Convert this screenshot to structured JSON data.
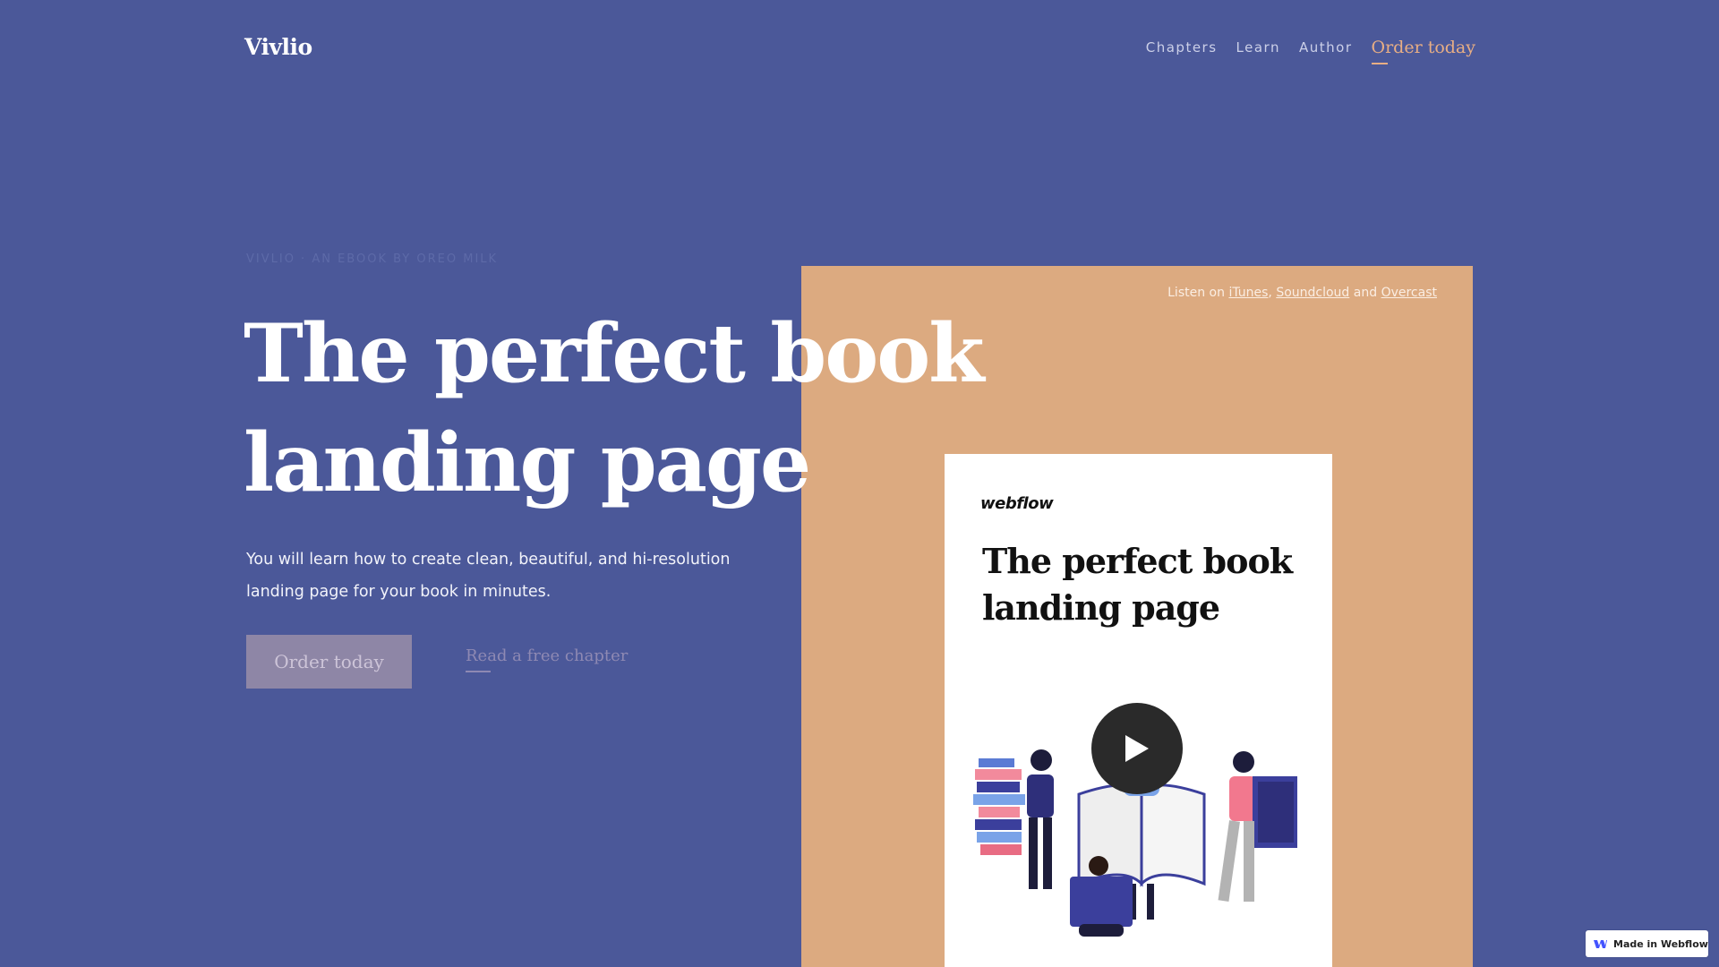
{
  "brand": {
    "logo": "Vivlio"
  },
  "nav": {
    "items": [
      "Chapters",
      "Learn",
      "Author"
    ],
    "cta": "Order today"
  },
  "hero": {
    "eyebrow": "Vivlio · An ebook by Oreo Milk",
    "title_line1": "The perfect book",
    "title_line2": "landing page",
    "subtitle": "You will learn how to create clean, beautiful, and hi-resolution landing page for your book in minutes.",
    "order_button": "Order today",
    "read_link": "Read a free chapter"
  },
  "listen": {
    "prefix": "Listen on",
    "itunes": "iTunes",
    "sep": ",",
    "soundcloud": "Soundcloud",
    "and": "and",
    "overcast": "Overcast"
  },
  "book": {
    "brand": "webflow",
    "title": "The perfect book landing page"
  },
  "badge": {
    "text": "Made in Webflow"
  },
  "colors": {
    "background": "#4b5899",
    "accent": "#e8ae84",
    "panel": "#dcaa80",
    "button": "#8e86a6"
  },
  "icons": [
    "play-icon",
    "webflow-logo-icon"
  ]
}
